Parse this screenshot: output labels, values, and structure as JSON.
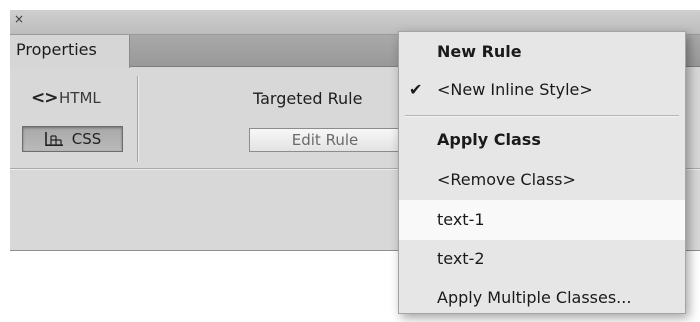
{
  "window": {
    "close_glyph": "×"
  },
  "panel": {
    "tab_label": "Properties",
    "html_mode_icon": "<>",
    "html_mode_label": "HTML",
    "css_mode_label": "CSS",
    "targeted_rule_label": "Targeted Rule",
    "edit_rule_label": "Edit Rule"
  },
  "menu": {
    "check_glyph": "✔",
    "new_rule_header": "New Rule",
    "new_inline_style": "<New Inline Style>",
    "apply_class_header": "Apply Class",
    "remove_class": "<Remove Class>",
    "class_1": "text-1",
    "class_2": "text-2",
    "apply_multiple": "Apply Multiple Classes..."
  }
}
